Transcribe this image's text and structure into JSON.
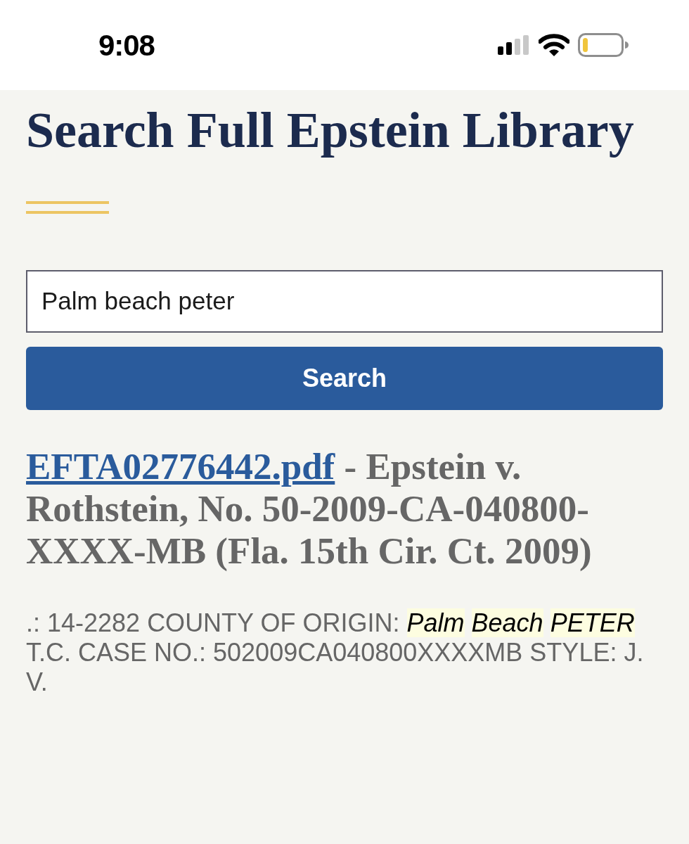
{
  "status_bar": {
    "time": "9:08"
  },
  "page": {
    "title": "Search Full Epstein Library"
  },
  "search": {
    "value": "Palm beach peter",
    "button": "Search"
  },
  "results": [
    {
      "link": "EFTA02776442.pdf",
      "description": "- Epstein v. Rothstein, No. 50-2009-CA-040800-XXXX-MB (Fla. 15th Cir. Ct. 2009)",
      "snippet": [
        {
          "text": ".: 14-2282 COUNTY OF ORIGIN:",
          "highlighted": false
        },
        {
          "text": "Palm",
          "highlighted": true
        },
        {
          "text": "Beach",
          "highlighted": true
        },
        {
          "text": "PETER",
          "highlighted": true
        },
        {
          "text": "T.C. CASE NO.: 502009CA040800XXXXMB STYLE: J. V.",
          "highlighted": false
        }
      ]
    }
  ]
}
